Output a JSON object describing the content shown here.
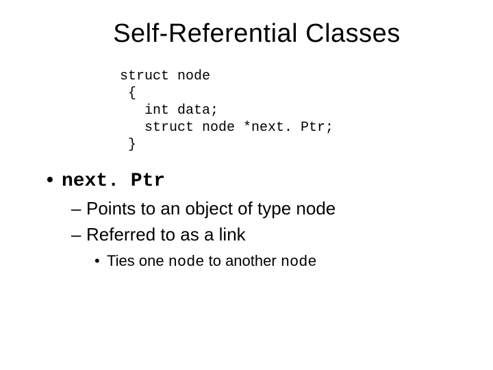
{
  "title": "Self-Referential Classes",
  "code": {
    "line1": "struct node",
    "line2": " {",
    "line3": "   int data;",
    "line4": "   struct node *next. Ptr;",
    "line5": " }"
  },
  "bullets": {
    "l1_marker": "•",
    "l1_text": "next. Ptr",
    "l2a_marker": "–",
    "l2a_text": "Points to an object of type node",
    "l2b_marker": "–",
    "l2b_text": "Referred to as a link",
    "l3_marker": "•",
    "l3_prefix": "Ties one ",
    "l3_code1": "node",
    "l3_mid": " to another ",
    "l3_code2": "node"
  }
}
